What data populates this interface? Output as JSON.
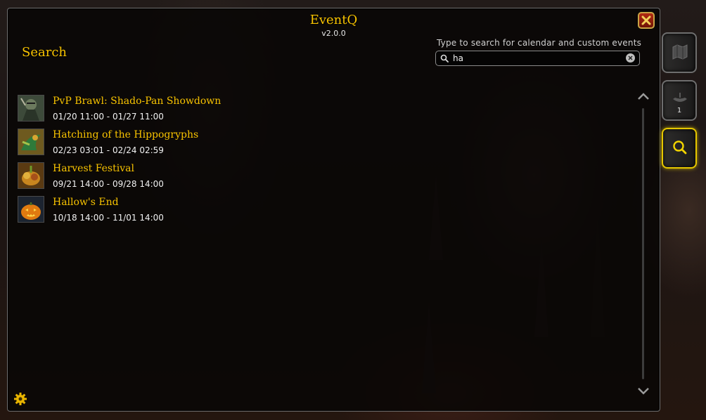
{
  "window": {
    "title": "EventQ",
    "version": "v2.0.0"
  },
  "section_heading": "Search",
  "search": {
    "hint": "Type to search for calendar and custom events",
    "value": "ha",
    "placeholder": ""
  },
  "events": [
    {
      "name": "PvP Brawl: Shado-Pan Showdown",
      "dates": "01/20 11:00 - 01/27 11:00",
      "icon": "pvp-brawl-icon"
    },
    {
      "name": "Hatching of the Hippogryphs",
      "dates": "02/23 03:01 - 02/24 02:59",
      "icon": "hippogryph-icon"
    },
    {
      "name": "Harvest Festival",
      "dates": "09/21 14:00 - 09/28 14:00",
      "icon": "harvest-festival-icon"
    },
    {
      "name": "Hallow's End",
      "dates": "10/18 14:00 - 11/01 14:00",
      "icon": "pumpkin-icon"
    }
  ],
  "side_tabs": [
    {
      "icon": "map-icon",
      "count": ""
    },
    {
      "icon": "boat-icon",
      "count": "1"
    },
    {
      "icon": "search-icon",
      "count": ""
    }
  ],
  "colors": {
    "accent_gold": "#f8c300",
    "active_tab_border": "#e6c700",
    "close_red": "#b32a12"
  }
}
